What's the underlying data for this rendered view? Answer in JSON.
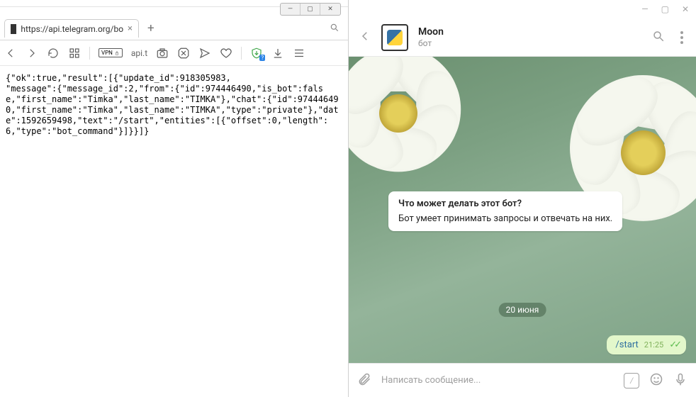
{
  "browser": {
    "window_controls": {
      "min": "—",
      "max": "▢",
      "close": "✕"
    },
    "tab": {
      "title": "https://api.telegram.org/bo",
      "close": "×"
    },
    "newtab": "+",
    "toolbar": {
      "vpn_label": "VPN",
      "addr": "api.t"
    },
    "shield_badge": "?",
    "body_text": "{\"ok\":true,\"result\":[{\"update_id\":918305983,\n\"message\":{\"message_id\":2,\"from\":{\"id\":974446490,\"is_bot\":false,\"first_name\":\"Timka\",\"last_name\":\"TIMKA\"},\"chat\":{\"id\":974446490,\"first_name\":\"Timka\",\"last_name\":\"TIMKA\",\"type\":\"private\"},\"date\":1592659498,\"text\":\"/start\",\"entities\":[{\"offset\":0,\"length\":6,\"type\":\"bot_command\"}]}}]}"
  },
  "telegram": {
    "window_controls": {
      "min": "—",
      "max": "▢",
      "close": "✕"
    },
    "chat": {
      "name": "Moon",
      "subtitle": "бот"
    },
    "info_card": {
      "question": "Что может делать этот бот?",
      "answer": "Бот умеет принимать запросы и отвечать на них."
    },
    "date_chip": "20 июня",
    "out_msg": {
      "text": "/start",
      "time": "21:25",
      "checks": "✓✓"
    },
    "input": {
      "placeholder": "Написать сообщение...",
      "cmd": "/"
    }
  }
}
